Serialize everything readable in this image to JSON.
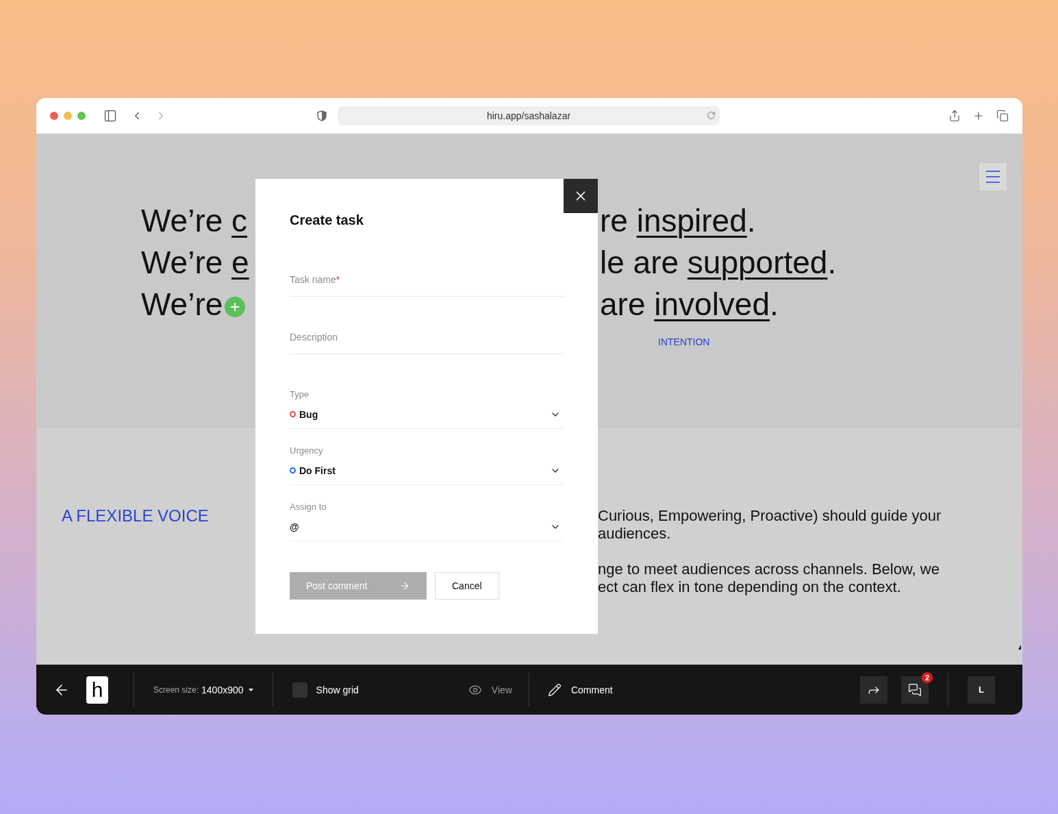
{
  "browser": {
    "url": "hiru.app/sashalazar"
  },
  "hero": {
    "lines": [
      {
        "left": [
          {
            "text": "We’re ",
            "underlined": false
          },
          {
            "text": "c",
            "underlined": true
          }
        ],
        "right": [
          {
            "text": "re ",
            "underlined": false
          },
          {
            "text": "inspired",
            "underlined": true
          },
          {
            "text": ".",
            "underlined": false
          }
        ]
      },
      {
        "left": [
          {
            "text": "We’re ",
            "underlined": false
          },
          {
            "text": "e",
            "underlined": true
          }
        ],
        "right": [
          {
            "text": "le are ",
            "underlined": false
          },
          {
            "text": "supported",
            "underlined": true
          },
          {
            "text": ".",
            "underlined": false
          }
        ]
      },
      {
        "left": [
          {
            "text": "We’re",
            "underlined": false
          }
        ],
        "right": [
          {
            "text": "are ",
            "underlined": false
          },
          {
            "text": "involved",
            "underlined": true
          },
          {
            "text": ".",
            "underlined": false
          }
        ]
      }
    ],
    "tag": "INTENTION"
  },
  "section": {
    "heading": "A FLEXIBLE VOICE",
    "paragraphs": [
      {
        "lines": [
          "Curious, Empowering, Proactive) should guide your",
          "audiences."
        ]
      },
      {
        "lines": [
          "nge to meet audiences across channels. Below, we",
          "ect can flex in tone depending on the context."
        ]
      }
    ]
  },
  "modal": {
    "title": "Create task",
    "text_fields": [
      {
        "placeholder": "Task name",
        "required_mark": "*"
      },
      {
        "placeholder": "Description"
      }
    ],
    "selects": [
      {
        "label": "Type",
        "value": "Bug",
        "color": "#e5484d"
      },
      {
        "label": "Urgency",
        "value": "Do First",
        "color": "#1e6ee8"
      },
      {
        "label": "Assign to",
        "value": "@"
      }
    ],
    "buttons": [
      {
        "kind": "primary",
        "label": "Post comment",
        "disabled": true
      },
      {
        "kind": "secondary",
        "label": "Cancel"
      }
    ]
  },
  "toolbar": {
    "logo": "h",
    "screen_size": {
      "label": "Screen size:",
      "value": "1400x900"
    },
    "show_grid": {
      "label": "Show grid",
      "checked": false
    },
    "modes": [
      {
        "label": "View",
        "selected": false
      },
      {
        "label": "Comment",
        "selected": true
      }
    ],
    "comments_badge": "2",
    "avatar": "L"
  }
}
